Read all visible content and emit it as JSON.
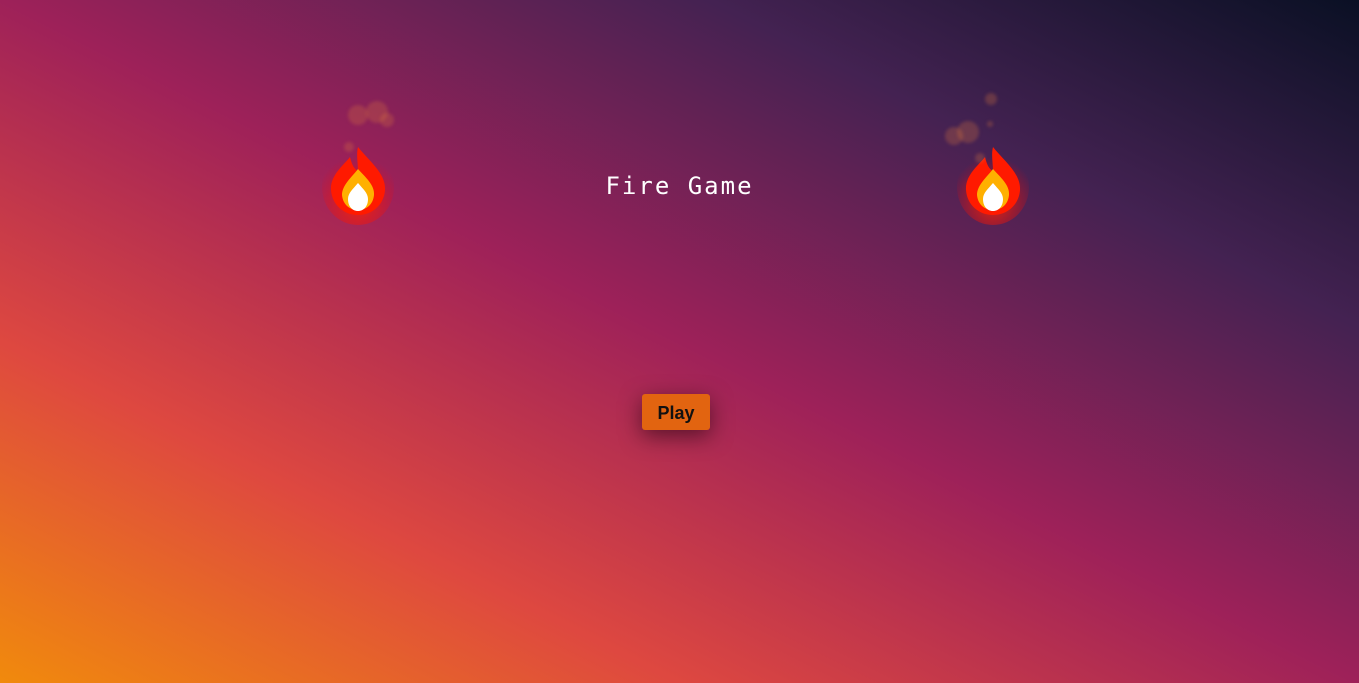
{
  "game": {
    "title": "Fire Game",
    "play_label": "Play"
  },
  "icons": {
    "left_fire": "fire-icon",
    "right_fire": "fire-icon"
  },
  "colors": {
    "button": "#e26410",
    "title_text": "#ffffff",
    "gradient_start": "#f18a0c",
    "gradient_end": "#0a1024"
  }
}
